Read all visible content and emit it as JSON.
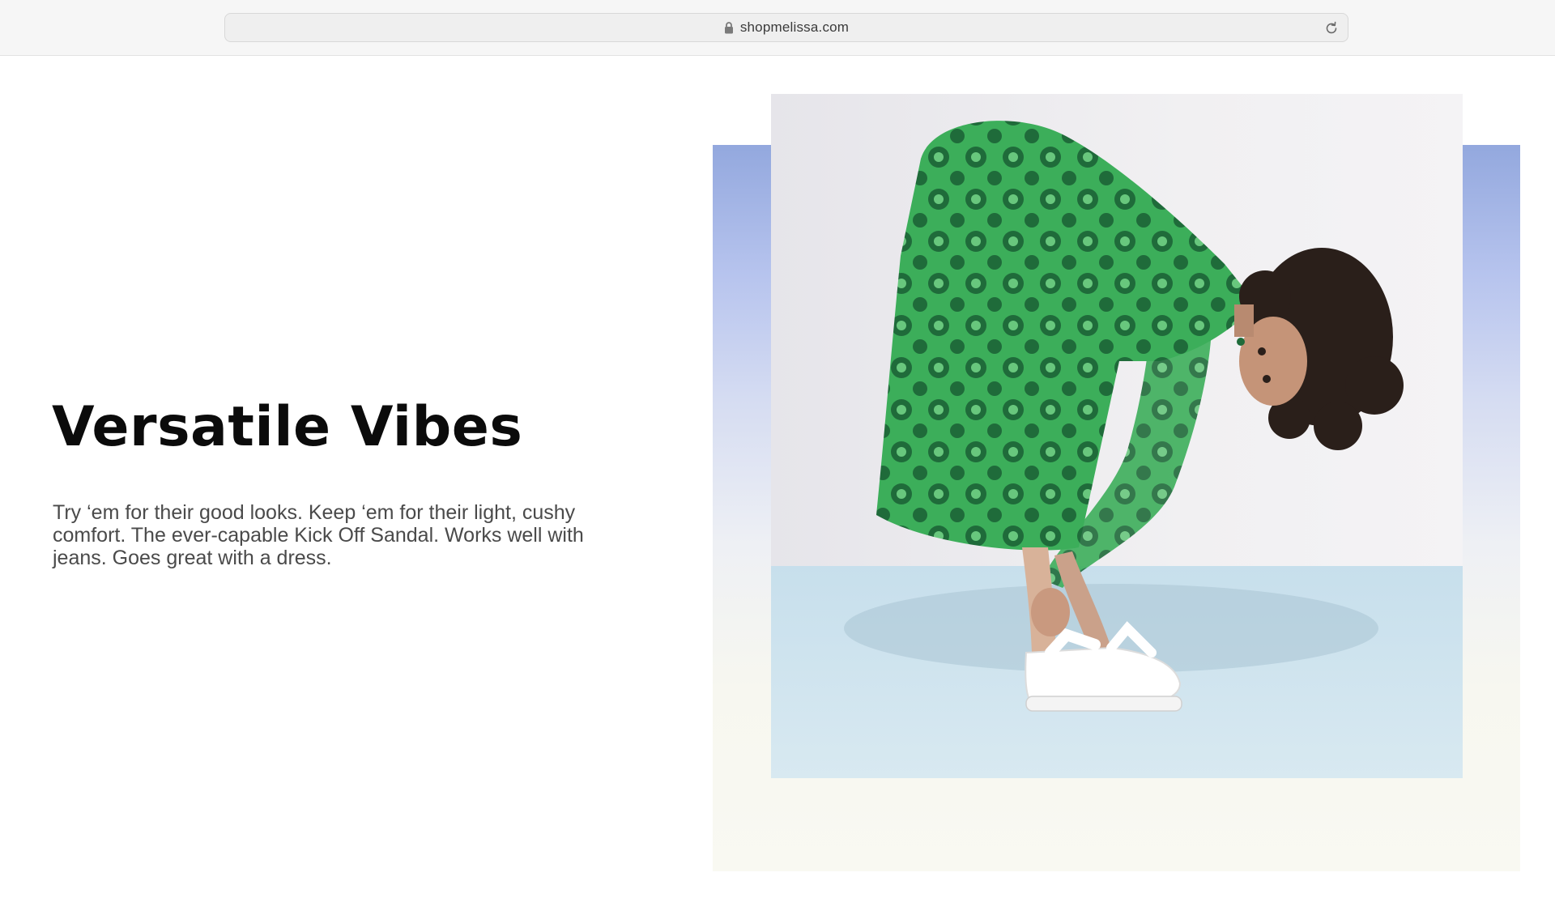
{
  "browser": {
    "url": "shopmelissa.com",
    "lock_icon": "lock-icon",
    "reload_icon": "reload-icon"
  },
  "hero": {
    "title": "Versatile Vibes",
    "description": "Try ‘em for their good looks. Keep ‘em for their light, cushy comfort. The ever-capable Kick Off Sandal. Works well with jeans. Goes great with a dress.",
    "image_subject": "model-in-green-dress-white-sandals"
  },
  "colors": {
    "text_dark": "#0b0b0b",
    "text_body": "#4a4a4a",
    "panel_top": "#93a8de",
    "panel_bottom": "#f9f9f2",
    "dress_green": "#3cae5a",
    "dress_dark": "#1f6b3a",
    "floor_blue": "#cfe3ee"
  }
}
